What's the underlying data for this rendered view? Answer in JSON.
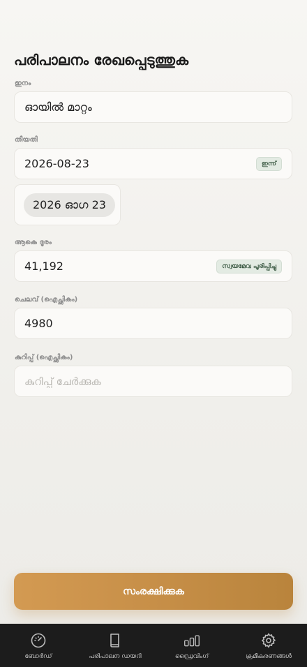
{
  "page": {
    "title": "പരിപാലനം രേഖപ്പെടുത്തുക"
  },
  "form": {
    "type": {
      "label": "ഇനം",
      "value": "ഓയിൽ മാറ്റം"
    },
    "date": {
      "label": "തീയതി",
      "value": "2026-08-23",
      "today_chip": "ഇന്ന്",
      "picker_display": "2026 ഓഗ 23"
    },
    "distance": {
      "label": "ആകെ ദൂരം",
      "value": "41,192",
      "autofill_chip": "സ്വയമേവ പൂരിപ്പിച്ചു"
    },
    "cost": {
      "label": "ചെലവ് (ഐച്ഛികം)",
      "value": "4980"
    },
    "note": {
      "label": "കുറിപ്പ് (ഐച്ഛികം)",
      "placeholder": "കുറിപ്പ് ചേർക്കുക"
    }
  },
  "actions": {
    "save_label": "സംരക്ഷിക്കുക"
  },
  "nav": {
    "items": [
      {
        "label": "ബോർഡ്",
        "icon": "gauge-icon"
      },
      {
        "label": "പരിപാലന ഡയറി",
        "icon": "book-icon"
      },
      {
        "label": "ഡ്രൈവിംഗ്",
        "icon": "bar-chart-icon"
      },
      {
        "label": "ക്രമീകരണങ്ങൾ",
        "icon": "gear-icon"
      }
    ]
  },
  "colors": {
    "accent": "#c78f48",
    "nav_bg": "#1c1c1c",
    "chip_green": "#3c5a44"
  }
}
